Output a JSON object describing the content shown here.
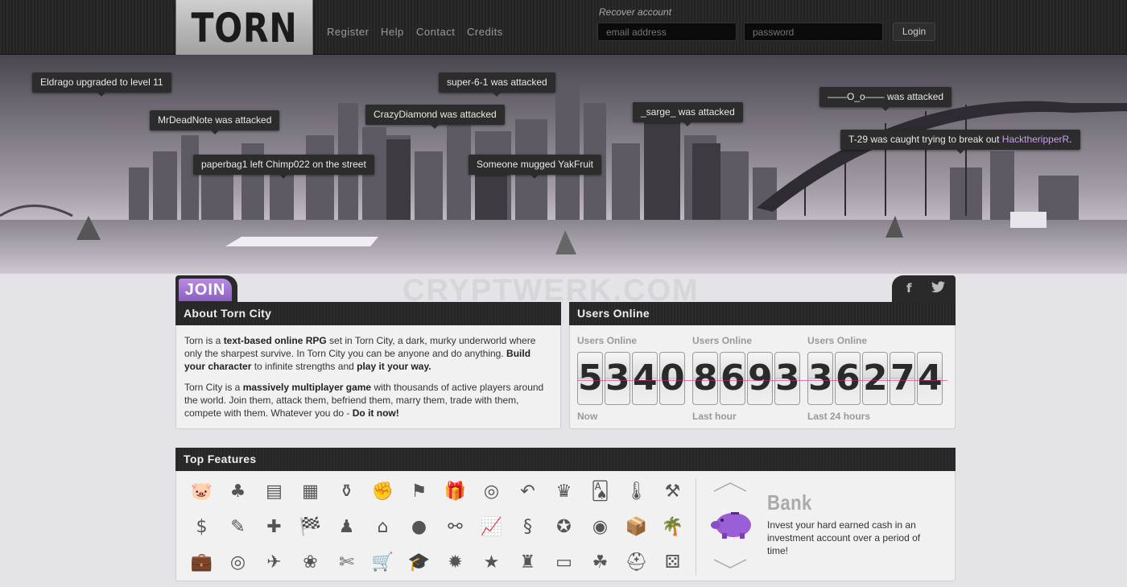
{
  "header": {
    "logo_text": "TORN",
    "nav": {
      "register": "Register",
      "help": "Help",
      "contact": "Contact",
      "credits": "Credits"
    },
    "recover": "Recover account",
    "email_placeholder": "email address",
    "password_placeholder": "password",
    "login": "Login"
  },
  "events": [
    "Eldrago upgraded to level 11",
    "super-6-1 was attacked",
    "MrDeadNote was attacked",
    "CrazyDiamond was attacked",
    "_sarge_ was attacked",
    "——O_o—— was attacked",
    "paperbag1 left Chimp022 on the street",
    "Someone mugged YakFruit"
  ],
  "event_caught": {
    "text": "T-29 was caught trying to break out ",
    "name": "HacktheripperR",
    "suffix": "."
  },
  "watermark": "CRYPTWERK.COM",
  "join": "JOIN",
  "social": {
    "facebook": "f",
    "twitter": "t"
  },
  "about": {
    "title": "About Torn City",
    "p1": {
      "a": "Torn is a ",
      "b": "text-based online RPG",
      "c": " set in Torn City, a dark, murky underworld where only the sharpest survive. In Torn City you can be anyone and do anything. ",
      "d": "Build your character",
      "e": " to infinite strengths and ",
      "f": "play it your way."
    },
    "p2": {
      "a": "Torn City is a ",
      "b": "massively multiplayer game",
      "c": " with thousands of active players around the world. Join them, attack them, befriend them, marry them, trade with them, compete with them. Whatever you do - ",
      "d": "Do it now!"
    }
  },
  "users_online": {
    "title": "Users Online",
    "counters": [
      {
        "label": "Users Online",
        "digits": [
          "5",
          "3",
          "4",
          "0"
        ],
        "period": "Now"
      },
      {
        "label": "Users Online",
        "digits": [
          "8",
          "6",
          "9",
          "3"
        ],
        "period": "Last hour"
      },
      {
        "label": "Users Online",
        "digits": [
          "3",
          "6",
          "2",
          "7",
          "4"
        ],
        "period": "Last 24 hours"
      }
    ]
  },
  "features": {
    "title": "Top Features",
    "icons": [
      "bank",
      "gang",
      "documents",
      "city",
      "chemistry",
      "grenade",
      "flag",
      "gift",
      "ring",
      "undo",
      "trophy",
      "casino",
      "thermometer",
      "auction",
      "dollar",
      "syringe",
      "medical",
      "racing-flag",
      "chess",
      "home",
      "fruit",
      "handcuffs",
      "stocks",
      "snake",
      "medal",
      "globe",
      "education",
      "island",
      "briefcase",
      "target",
      "plane",
      "crystal",
      "knife",
      "shopping-cart",
      "graduate",
      "sun",
      "star",
      "hat",
      "newspaper",
      "friends",
      "helmet",
      "dice"
    ],
    "icon_glyphs": [
      "🐷",
      "♣",
      "▤",
      "▦",
      "⚱",
      "✊",
      "⚑",
      "🎁",
      "◎",
      "↶",
      "♛",
      "🂡",
      "🌡",
      "⚒",
      "$",
      "✎",
      "✚",
      "🏁",
      "♟",
      "⌂",
      "●",
      "⚯",
      "📈",
      "§",
      "✪",
      "◉",
      "📦",
      "🌴",
      "💼",
      "◎",
      "✈",
      "❀",
      "✄",
      "🛒",
      "🎓",
      "✹",
      "★",
      "♜",
      "▭",
      "☘",
      "⛑",
      "⚄"
    ],
    "bank": {
      "title": "Bank",
      "desc": "Invest your hard earned cash in an investment account over a period of time!"
    }
  }
}
